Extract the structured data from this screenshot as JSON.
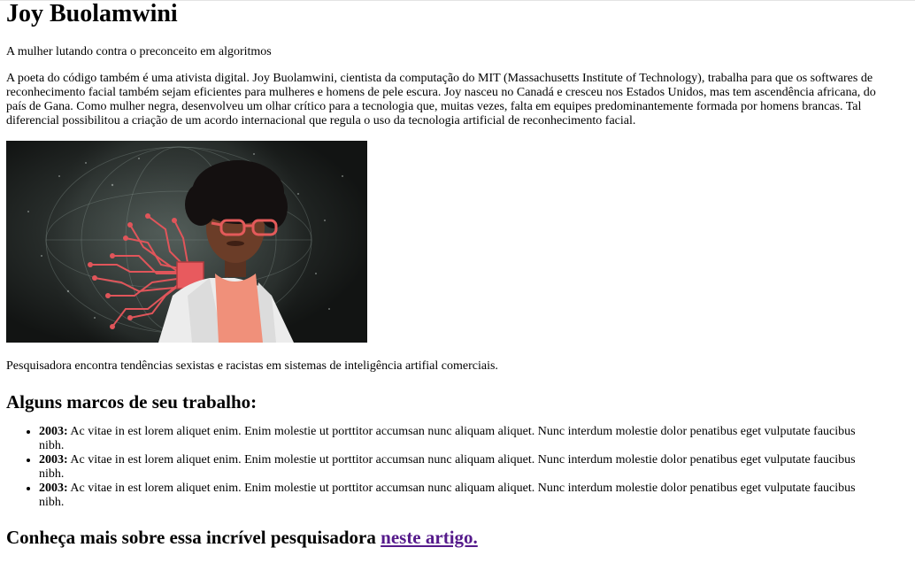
{
  "article": {
    "title": "Joy Buolamwini",
    "subtitle": "A mulher lutando contra o preconceito em algoritmos",
    "intro": "A poeta do código também é uma ativista digital. Joy Buolamwini, cientista da computação do MIT (Massachusetts Institute of Technology), trabalha para que os softwares de reconhecimento facial também sejam eficientes para mulheres e homens de pele escura. Joy nasceu no Canadá e cresceu nos Estados Unidos, mas tem ascendência africana, do país de Gana. Como mulher negra, desenvolveu um olhar crítico para a tecnologia que, muitas vezes, falta em equipes predominantemente formada por homens brancas. Tal diferencial possibilitou a criação de um acordo internacional que regula o uso da tecnologia artificial de reconhecimento facial.",
    "caption": "Pesquisadora encontra tendências sexistas e racistas em sistemas de inteligência artifial comerciais.",
    "milestones_heading": "Alguns marcos de seu trabalho:",
    "milestones": [
      {
        "year": "2003:",
        "text": " Ac vitae in est lorem aliquet enim. Enim molestie ut porttitor accumsan nunc aliquam aliquet. Nunc interdum molestie dolor penatibus eget vulputate faucibus nibh."
      },
      {
        "year": "2003:",
        "text": " Ac vitae in est lorem aliquet enim. Enim molestie ut porttitor accumsan nunc aliquam aliquet. Nunc interdum molestie dolor penatibus eget vulputate faucibus nibh."
      },
      {
        "year": "2003:",
        "text": " Ac vitae in est lorem aliquet enim. Enim molestie ut porttitor accumsan nunc aliquam aliquet. Nunc interdum molestie dolor penatibus eget vulputate faucibus nibh."
      }
    ],
    "more_text": "Conheça mais sobre essa incrível pesquisadora ",
    "more_link": "neste artigo."
  },
  "colors": {
    "visited_link": "#551a8b",
    "circuit": "#e0555a",
    "blouse": "#f0907a",
    "jacket": "#ececec",
    "background": "#1a1d1c"
  },
  "icons": {
    "photo": "portrait-photo"
  }
}
